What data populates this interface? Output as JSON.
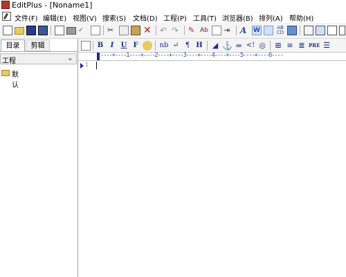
{
  "window": {
    "title": "EditPlus - [Noname1]"
  },
  "menu": [
    "文件(F)",
    "编辑(E)",
    "视图(V)",
    "搜索(S)",
    "文档(D)",
    "工程(P)",
    "工具(T)",
    "浏览器(B)",
    "排列(A)",
    "帮助(H)"
  ],
  "toolbar_icons": [
    "new-file",
    "open",
    "save",
    "save-all",
    "print-preview",
    "print",
    "spell-check",
    "print-preview-2",
    "cut",
    "copy",
    "paste",
    "delete",
    "undo",
    "redo",
    "find-highlight",
    "replace",
    "find-in-files",
    "indent",
    "font-a",
    "word-wrap",
    "line-numbers",
    "ruler",
    "text-colors",
    "layout-1",
    "layout-2",
    "fullscreen",
    "close-window"
  ],
  "left_panel": {
    "tabs": [
      "目录",
      "剪辑"
    ],
    "dropdown_value": "工程",
    "tree_items": [
      "默认"
    ]
  },
  "html_toolbar": {
    "labels": [
      "B",
      "I",
      "U",
      "F",
      "nb",
      "↵",
      "¶",
      "H"
    ]
  },
  "ruler_text": "----+----1----+----2----+----3----+----4----+----5----+----6----",
  "editor": {
    "line_numbers": [
      "1"
    ]
  }
}
